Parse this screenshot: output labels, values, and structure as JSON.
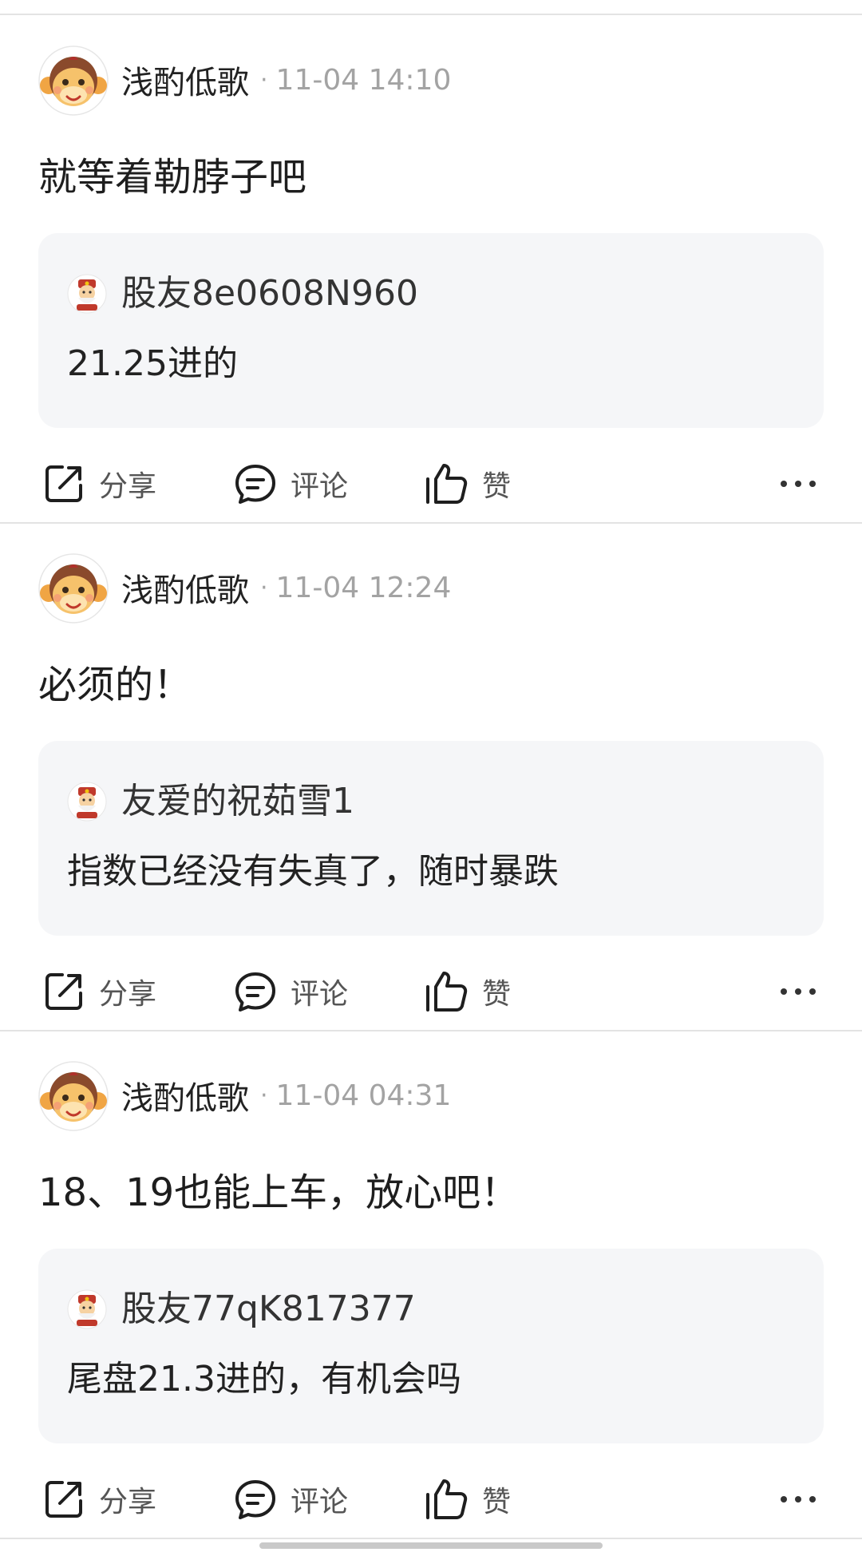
{
  "posts": [
    {
      "author": "浅酌低歌",
      "dot": "·",
      "time": "11-04 14:10",
      "content": "就等着勒脖子吧",
      "quote": {
        "author": "股友8e0608N960",
        "text": "21.25进的"
      },
      "actions": {
        "share": "分享",
        "comment": "评论",
        "like": "赞"
      }
    },
    {
      "author": "浅酌低歌",
      "dot": "·",
      "time": "11-04 12:24",
      "content": "必须的！",
      "quote": {
        "author": "友爱的祝茹雪1",
        "text": "指数已经没有失真了，随时暴跌"
      },
      "actions": {
        "share": "分享",
        "comment": "评论",
        "like": "赞"
      }
    },
    {
      "author": "浅酌低歌",
      "dot": "·",
      "time": "11-04 04:31",
      "content": "18、19也能上车，放心吧！",
      "quote": {
        "author": "股友77qK817377",
        "text": "尾盘21.3进的，有机会吗"
      },
      "actions": {
        "share": "分享",
        "comment": "评论",
        "like": "赞"
      }
    }
  ],
  "icons": {
    "avatar": "monkey-avatar-icon",
    "quote_avatar": "fortune-god-avatar-icon",
    "share": "share-icon",
    "comment": "comment-icon",
    "like": "thumbs-up-icon",
    "more": "more-icon"
  },
  "colors": {
    "text_primary": "#1e1e1e",
    "text_meta": "#a3a3a3",
    "quote_bg": "#f5f6f8",
    "divider": "#e3e3e3",
    "avatar_face": "#f4b54a",
    "avatar_hair": "#8a4a2c"
  }
}
